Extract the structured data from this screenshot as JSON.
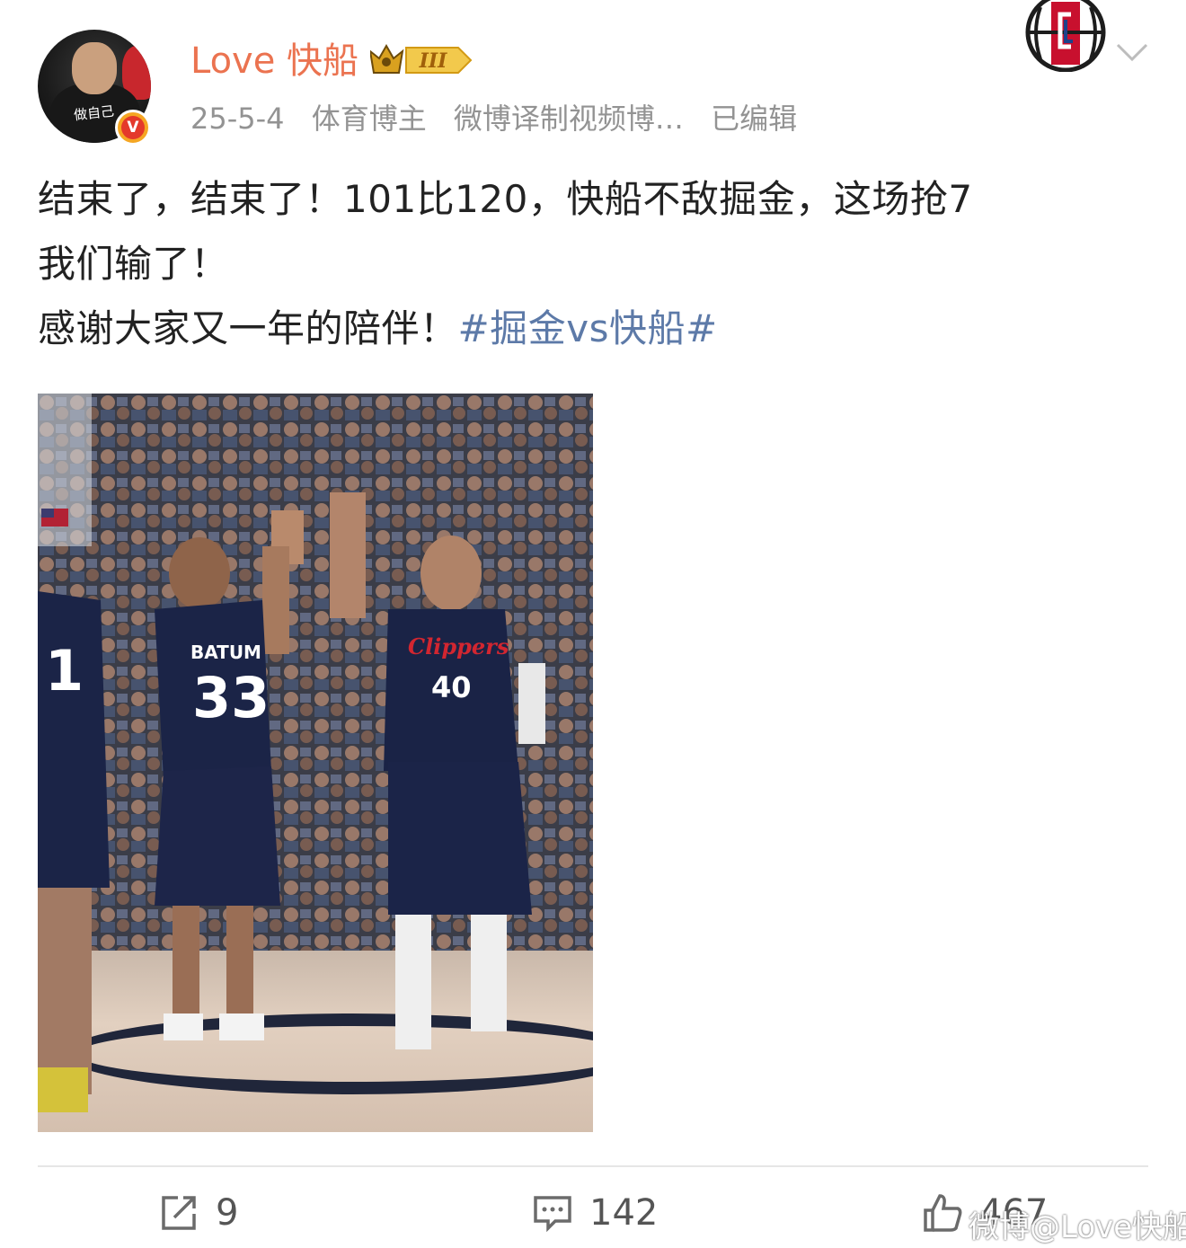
{
  "user": {
    "name": "Love 快船",
    "avatar_text": "做自己",
    "level_badge": "III",
    "verified_mark": "V"
  },
  "meta": {
    "date": "25-5-4",
    "tag1": "体育博主",
    "tag2": "微博译制视频博…",
    "edited": "已编辑"
  },
  "post": {
    "line1": "结束了，结束了！101比120，快船不敌掘金，这场抢7",
    "line2": "我们输了！",
    "line3_text": "感谢大家又一年的陪伴！",
    "hashtag": "#掘金vs快船#"
  },
  "photo": {
    "player1_name": "BATUM",
    "player1_number": "33",
    "player2_team": "Clippers",
    "player2_number": "40",
    "player3_number": "1"
  },
  "actions": {
    "repost_count": "9",
    "comment_count": "142",
    "like_count": "467"
  },
  "watermark": "微博@Love快船",
  "colors": {
    "username": "#eb7350",
    "hashtag": "#5d7aa8",
    "meta": "#939393"
  }
}
